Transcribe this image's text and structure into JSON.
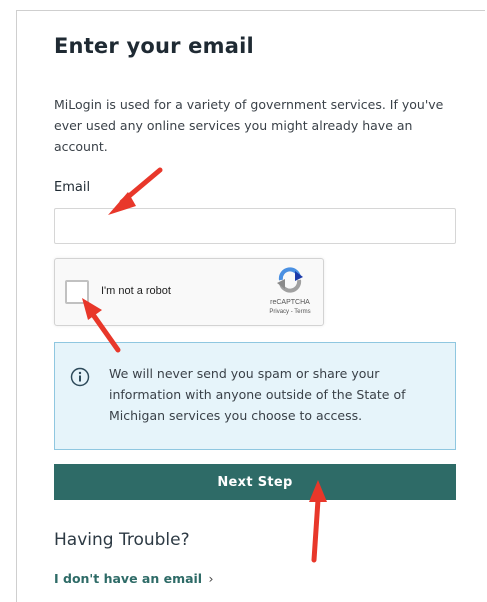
{
  "page": {
    "title": "Enter your email",
    "intro": "MiLogin is used for a variety of government services. If you've ever used any online services you might already have an account."
  },
  "email": {
    "label": "Email",
    "value": "",
    "placeholder": ""
  },
  "captcha": {
    "label": "I'm not a robot",
    "brand": "reCAPTCHA",
    "links": "Privacy - Terms",
    "checked": false,
    "logo_icon": "recaptcha-logo-icon"
  },
  "notice": {
    "icon": "info-icon",
    "text": "We will never send you spam or share your information with anyone outside of the State of Michigan services you choose to access."
  },
  "actions": {
    "next_label": "Next Step"
  },
  "help": {
    "heading": "Having Trouble?",
    "no_email_link": "I don't have an email",
    "chevron": "›"
  },
  "annotations": {
    "arrow_icon": "red-arrow-icon",
    "arrow_color": "#e8372a"
  },
  "colors": {
    "primary": "#2e6b67",
    "info_bg": "#e6f4fa",
    "info_border": "#8fc7e0"
  }
}
